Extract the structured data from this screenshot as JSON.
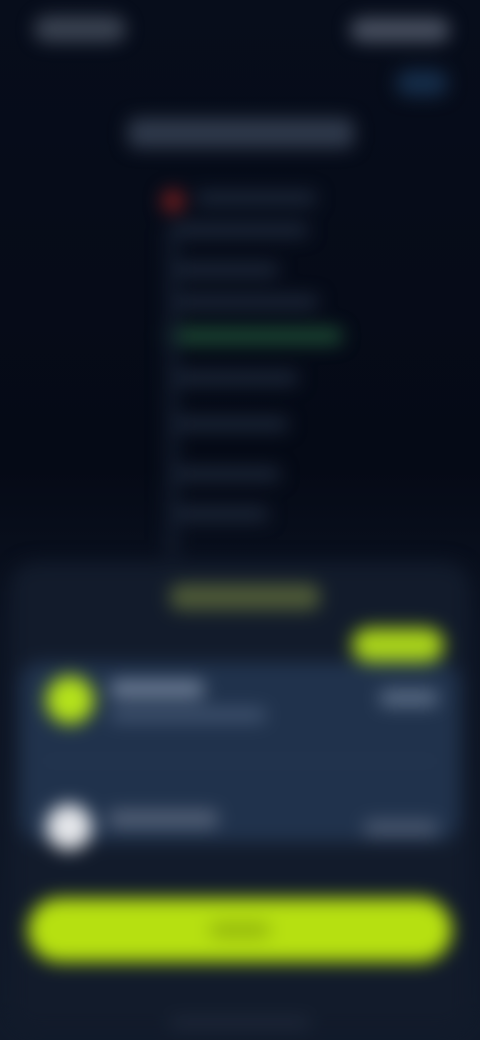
{
  "colors": {
    "background": "#050a14",
    "sheet": "#121b2b",
    "selected_row": "#20324c",
    "accent": "#b6e011",
    "danger_dot": "#7a1f1f",
    "success_bar": "#2f7d4a"
  },
  "status_bar": {
    "time": "",
    "indicators": ""
  },
  "header": {
    "help_label": ""
  },
  "document": {
    "title": ""
  },
  "sheet": {
    "title": "",
    "pill_label": "",
    "options": [
      {
        "title": "",
        "subtitle": "",
        "value": "",
        "icon": "accent-circle-icon"
      },
      {
        "title": "",
        "subtitle": "",
        "value": "",
        "icon": "white-circle-icon"
      }
    ],
    "cta_label": ""
  }
}
